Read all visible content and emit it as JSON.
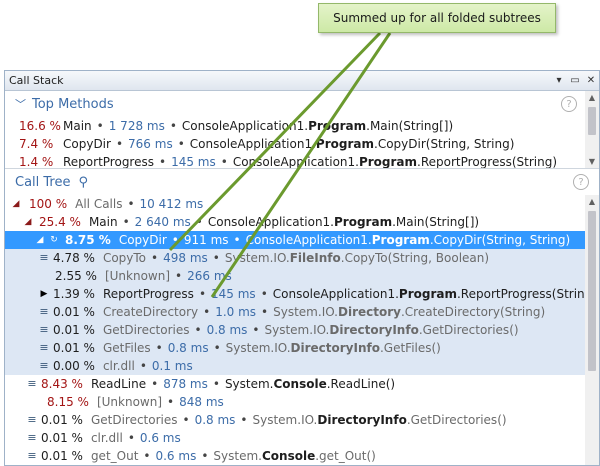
{
  "callout": {
    "text": "Summed up for all folded subtrees"
  },
  "window": {
    "title": "Call Stack",
    "ctrl_dropdown": "▾",
    "ctrl_restore": "▭",
    "ctrl_close": "✕"
  },
  "top_methods": {
    "label": "Top Methods",
    "help": "?",
    "rows": [
      {
        "pct": "16.6 %",
        "name": "Main",
        "time": "1 728 ms",
        "ns": "ConsoleApplication1.",
        "cls": "Program",
        "method": ".Main(String[])"
      },
      {
        "pct": "7.4 %",
        "name": "CopyDir",
        "time": "766 ms",
        "ns": "ConsoleApplication1.",
        "cls": "Program",
        "method": ".CopyDir(String, String)"
      },
      {
        "pct": "1.4 %",
        "name": "ReportProgress",
        "time": "145 ms",
        "ns": "ConsoleApplication1.",
        "cls": "Program",
        "method": ".ReportProgress(String)"
      }
    ]
  },
  "call_tree": {
    "label": "Call Tree",
    "help": "?",
    "rows": [
      {
        "pct": "100 %",
        "name": "All Calls",
        "time": "10 412 ms",
        "ns": "",
        "cls": "",
        "method": ""
      },
      {
        "pct": "25.4 %",
        "name": "Main",
        "time": "2 640 ms",
        "ns": "ConsoleApplication1.",
        "cls": "Program",
        "method": ".Main(String[])"
      },
      {
        "pct": "8.75 %",
        "name": "CopyDir",
        "time": "911 ms",
        "ns": "ConsoleApplication1.",
        "cls": "Program",
        "method": ".CopyDir(String, String)"
      },
      {
        "pct": "4.78 %",
        "name": "CopyTo",
        "time": "498 ms",
        "ns": "System.IO.",
        "cls": "FileInfo",
        "method": ".CopyTo(String, Boolean)"
      },
      {
        "pct": "2.55 %",
        "name": "[Unknown]",
        "time": "266 ms",
        "ns": "",
        "cls": "",
        "method": ""
      },
      {
        "pct": "1.39 %",
        "name": "ReportProgress",
        "time": "145 ms",
        "ns": "ConsoleApplication1.",
        "cls": "Program",
        "method": ".ReportProgress(String)"
      },
      {
        "pct": "0.01 %",
        "name": "CreateDirectory",
        "time": "1.0 ms",
        "ns": "System.IO.",
        "cls": "Directory",
        "method": ".CreateDirectory(String)"
      },
      {
        "pct": "0.01 %",
        "name": "GetDirectories",
        "time": "0.8 ms",
        "ns": "System.IO.",
        "cls": "DirectoryInfo",
        "method": ".GetDirectories()"
      },
      {
        "pct": "0.01 %",
        "name": "GetFiles",
        "time": "0.8 ms",
        "ns": "System.IO.",
        "cls": "DirectoryInfo",
        "method": ".GetFiles()"
      },
      {
        "pct": "0.00 %",
        "name": "clr.dll",
        "time": "0.1 ms",
        "ns": "",
        "cls": "",
        "method": ""
      },
      {
        "pct": "8.43 %",
        "name": "ReadLine",
        "time": "878 ms",
        "ns": "System.",
        "cls": "Console",
        "method": ".ReadLine()"
      },
      {
        "pct": "8.15 %",
        "name": "[Unknown]",
        "time": "848 ms",
        "ns": "",
        "cls": "",
        "method": ""
      },
      {
        "pct": "0.01 %",
        "name": "GetDirectories",
        "time": "0.8 ms",
        "ns": "System.IO.",
        "cls": "DirectoryInfo",
        "method": ".GetDirectories()"
      },
      {
        "pct": "0.01 %",
        "name": "clr.dll",
        "time": "0.6 ms",
        "ns": "",
        "cls": "",
        "method": ""
      },
      {
        "pct": "0.01 %",
        "name": "get_Out",
        "time": "0.6 ms",
        "ns": "System.",
        "cls": "Console",
        "method": ".get_Out()"
      }
    ]
  },
  "colors": {
    "accent": "#3c6ca8",
    "selection": "#3399ff",
    "percent_red": "#a31515",
    "callout_bg": "#d6edb3",
    "leader_line": "#6b9a2e"
  }
}
